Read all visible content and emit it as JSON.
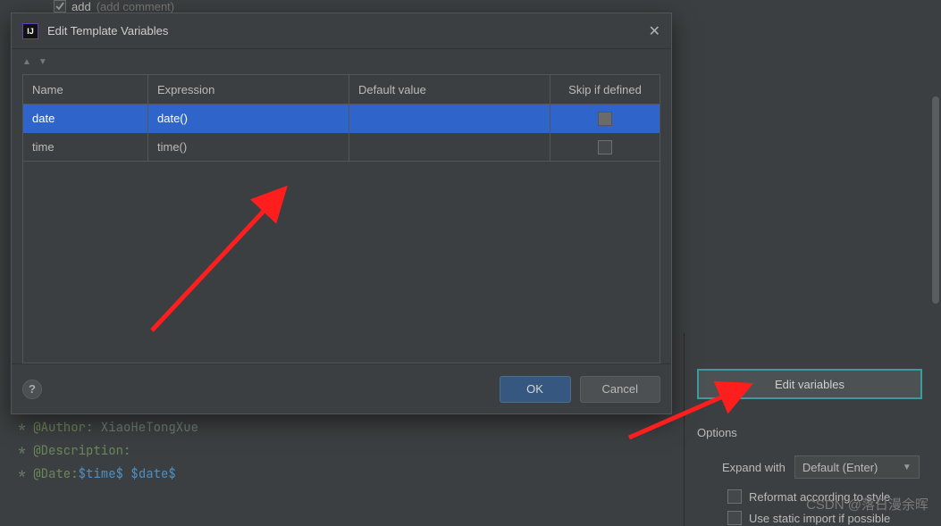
{
  "bgTop": {
    "label": "add",
    "hint": "(add comment)"
  },
  "dialog": {
    "title": "Edit Template Variables",
    "columns": {
      "name": "Name",
      "expression": "Expression",
      "default": "Default value",
      "skip": "Skip if defined"
    },
    "rows": [
      {
        "name": "date",
        "expression": "date()",
        "default": "",
        "skip": false,
        "selected": true
      },
      {
        "name": "time",
        "expression": "time()",
        "default": "",
        "skip": false,
        "selected": false
      }
    ],
    "ok": "OK",
    "cancel": "Cancel",
    "help": "?"
  },
  "rightPanel": {
    "editVariables": "Edit variables",
    "optionsTitle": "Options",
    "expandWith": "Expand with",
    "expandValue": "Default (Enter)",
    "reformat": "Reformat according to style",
    "staticImport": "Use static import if possible"
  },
  "code": {
    "line1_pre": " * ",
    "line1_tag": "@Author:",
    "line1_rest": " XiaoHeTongXue",
    "line2_pre": " * ",
    "line2_tag": "@Description:",
    "line3_pre": " * ",
    "line3_tag": "@Date:",
    "line3_var1": "$time$",
    "line3_sep": " ",
    "line3_var2": "$date$"
  },
  "watermark": "CSDN @落日漫余晖"
}
